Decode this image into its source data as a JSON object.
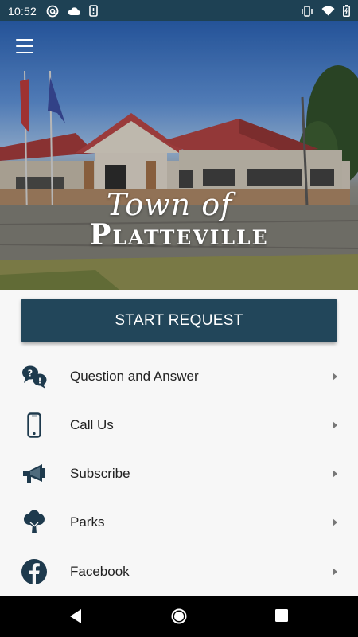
{
  "status_bar": {
    "time": "10:52",
    "icons_left": [
      "at-sign-icon",
      "cloud-icon",
      "phone-alert-icon"
    ],
    "icons_right": [
      "vibrate-icon",
      "wifi-icon",
      "battery-icon"
    ]
  },
  "hero": {
    "logo_top": "Town of",
    "logo_main": "Platteville",
    "menu_icon": "hamburger-menu-icon"
  },
  "actions": {
    "start_request_label": "START REQUEST"
  },
  "menu": {
    "items": [
      {
        "label": "Question and Answer",
        "icon": "question-bubbles-icon"
      },
      {
        "label": "Call Us",
        "icon": "phone-icon"
      },
      {
        "label": "Subscribe",
        "icon": "megaphone-icon"
      },
      {
        "label": "Parks",
        "icon": "tree-icon"
      },
      {
        "label": "Facebook",
        "icon": "facebook-icon"
      }
    ]
  },
  "colors": {
    "status_bar": "#1e4154",
    "primary_button": "#22465a",
    "icon": "#1e3a4d",
    "list_bg": "#f7f7f7"
  }
}
